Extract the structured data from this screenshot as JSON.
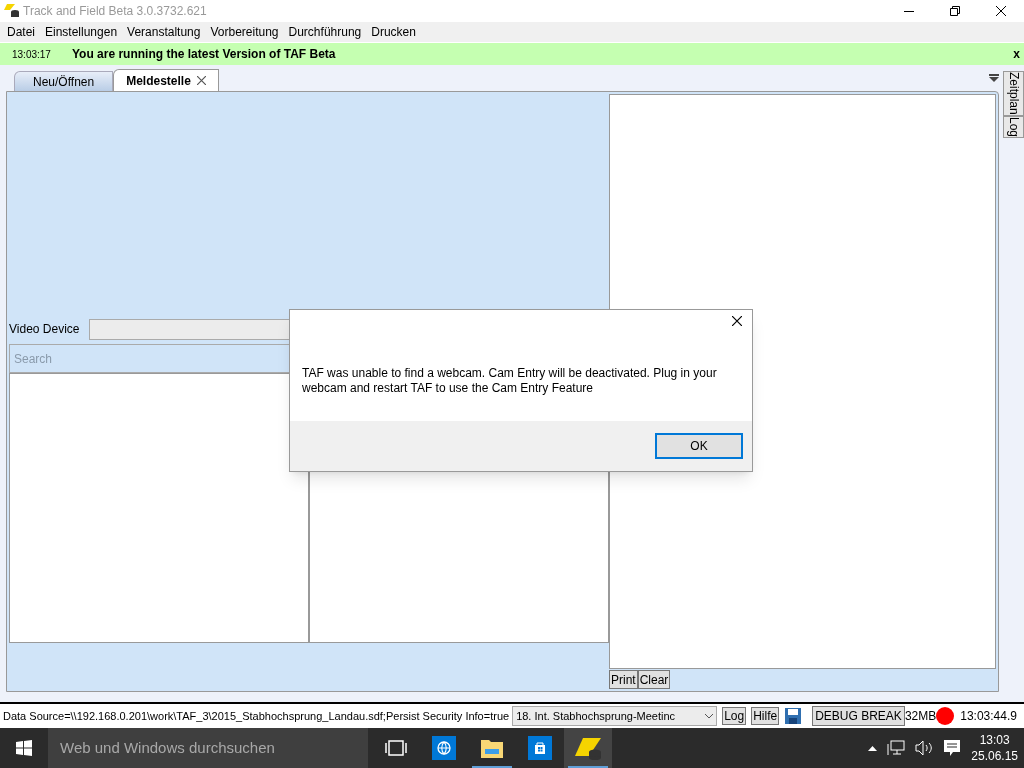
{
  "window": {
    "title": "Track and Field Beta 3.0.3732.621"
  },
  "menu": [
    "Datei",
    "Einstellungen",
    "Veranstaltung",
    "Vorbereitung",
    "Durchführung",
    "Drucken"
  ],
  "notification": {
    "time": "13:03:17",
    "message": "You are running the latest Version of TAF Beta",
    "close": "x"
  },
  "tabs": [
    {
      "label": "Neu/Öffnen",
      "selected": false,
      "closable": false
    },
    {
      "label": "Meldestelle",
      "selected": true,
      "closable": true
    }
  ],
  "side_tabs": [
    "Zeitplan",
    "Log"
  ],
  "video_device": {
    "label": "Video Device"
  },
  "search": {
    "placeholder": "Search"
  },
  "log_buttons": [
    "Print",
    "Clear"
  ],
  "dialog": {
    "message": "TAF was unable to find a webcam. Cam Entry will be deactivated. Plug in your webcam and restart TAF to use the Cam Entry Feature",
    "button": "OK"
  },
  "status_bar": {
    "data_source": "Data Source=\\\\192.168.0.201\\work\\TAF_3\\2015_Stabhochsprung_Landau.sdf;Persist Security Info=true",
    "meeting": "18. Int. Stabhochsprung-Meetinc",
    "buttons": [
      "Log",
      "Hilfe"
    ],
    "debug": "DEBUG BREAK",
    "memory": "32MB",
    "time": "13:03:44.9"
  },
  "taskbar": {
    "search_placeholder": "Web und Windows durchsuchen",
    "apps": [
      {
        "kind": "taskview",
        "running": false,
        "selected": false
      },
      {
        "kind": "browser",
        "running": false,
        "selected": false
      },
      {
        "kind": "explorer",
        "running": true,
        "selected": false
      },
      {
        "kind": "store",
        "running": false,
        "selected": false
      },
      {
        "kind": "taf",
        "running": true,
        "selected": true
      }
    ],
    "time": "13:03",
    "date": "25.06.15"
  }
}
